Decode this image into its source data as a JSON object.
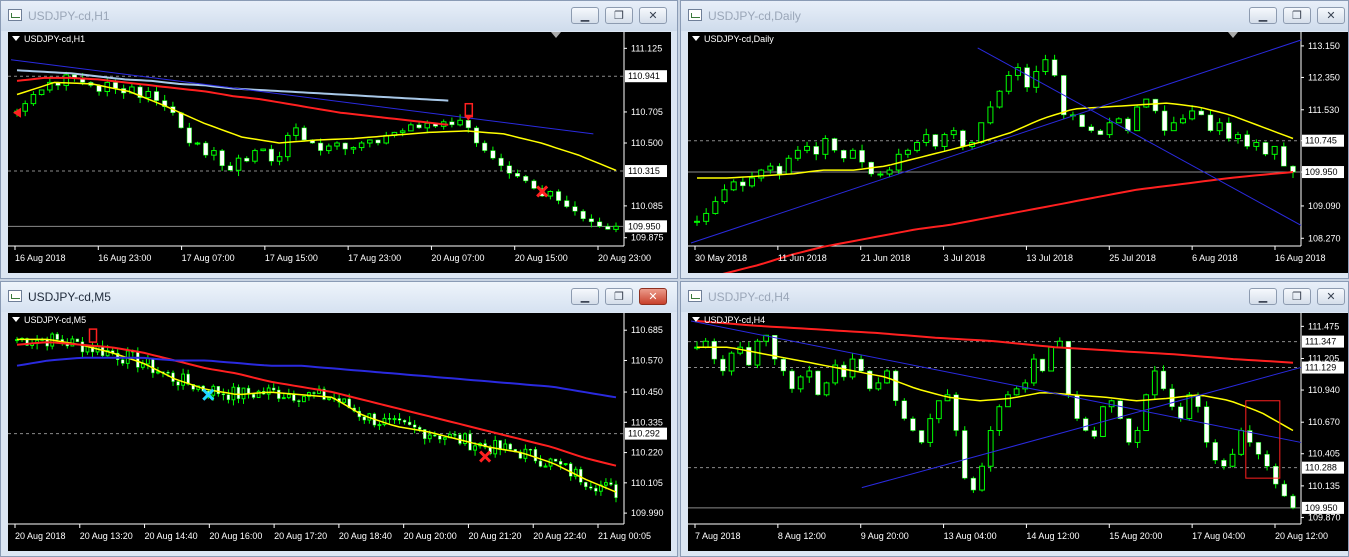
{
  "colors": {
    "up": "#00ff00",
    "ma20": "#ffff00",
    "ma50": "#ff2020",
    "ma100": "#2a2adf",
    "ma_light": "#a8c8e8",
    "axis": "#ffffff",
    "grid": "#8a8a8a"
  },
  "windows": [
    {
      "id": "h1",
      "title": "USDJPY-cd,H1",
      "symbol": "USDJPY-cd,H1",
      "controls": [
        "minimize",
        "restore",
        "close"
      ],
      "chart_data": {
        "type": "candlestick",
        "timeframe": "H1",
        "ylim": [
          109.84,
          111.18
        ],
        "yticks": [
          {
            "v": 111.125,
            "t": "111.125"
          },
          {
            "v": 110.705,
            "t": "110.705"
          },
          {
            "v": 110.5,
            "t": "110.500"
          },
          {
            "v": 110.085,
            "t": "110.085"
          },
          {
            "v": 109.875,
            "t": "109.875"
          }
        ],
        "highlights": [
          {
            "v": 110.941,
            "t": "110.941",
            "dash": true
          },
          {
            "v": 110.315,
            "t": "110.315",
            "dash": true
          },
          {
            "v": 109.95,
            "t": "109.950",
            "dash": false
          }
        ],
        "xlabels": [
          "16 Aug 2018",
          "16 Aug 23:00",
          "17 Aug 07:00",
          "17 Aug 15:00",
          "17 Aug 23:00",
          "20 Aug 07:00",
          "20 Aug 15:00",
          "20 Aug 23:00"
        ],
        "n": 74,
        "closes": [
          110.71,
          110.76,
          110.82,
          110.85,
          110.9,
          110.88,
          110.95,
          110.93,
          110.9,
          110.88,
          110.84,
          110.9,
          110.86,
          110.83,
          110.87,
          110.8,
          110.84,
          110.78,
          110.74,
          110.7,
          110.6,
          110.5,
          110.5,
          110.42,
          110.45,
          110.35,
          110.32,
          110.4,
          110.38,
          110.45,
          110.46,
          110.38,
          110.41,
          110.55,
          110.6,
          110.52,
          110.5,
          110.45,
          110.48,
          110.5,
          110.46,
          110.47,
          110.5,
          110.52,
          110.5,
          110.55,
          110.57,
          110.58,
          110.62,
          110.6,
          110.63,
          110.61,
          110.64,
          110.62,
          110.65,
          110.6,
          110.5,
          110.45,
          110.4,
          110.35,
          110.3,
          110.28,
          110.25,
          110.2,
          110.15,
          110.18,
          110.12,
          110.08,
          110.05,
          110.0,
          109.98,
          109.95,
          109.93,
          109.95
        ],
        "lines": [
          {
            "style": "ma20",
            "from": [
              0,
              110.82
            ],
            "to": [
              73,
              110.32
            ],
            "curve": [
              110.82,
              110.9,
              110.89,
              110.84,
              110.74,
              110.63,
              110.54,
              110.5,
              110.52,
              110.53,
              110.55,
              110.57,
              110.58,
              110.56,
              110.5,
              110.42,
              110.32
            ]
          },
          {
            "style": "ma50",
            "curve": [
              110.91,
              110.93,
              110.93,
              110.92,
              110.9,
              110.88,
              110.86,
              110.84,
              110.81,
              110.79,
              110.76,
              110.73,
              110.7,
              110.68,
              110.66,
              110.64,
              110.62
            ]
          },
          {
            "style": "ma_light",
            "curve": [
              110.98,
              110.97,
              110.96,
              110.94,
              110.92,
              110.91,
              110.89,
              110.88,
              110.86,
              110.85,
              110.84,
              110.83,
              110.82,
              110.81,
              110.8,
              110.79,
              110.78
            ]
          }
        ],
        "trend": [
          [
            0,
            111.05
          ],
          [
            95,
            110.56
          ]
        ],
        "markers": [
          {
            "i": 0,
            "v": 110.7,
            "kind": "red-arrow-left"
          },
          {
            "i": 55,
            "v": 110.7,
            "kind": "red-box-arrow"
          },
          {
            "i": 64,
            "v": 110.18,
            "kind": "red-x"
          }
        ]
      }
    },
    {
      "id": "daily",
      "title": "USDJPY-cd,Daily",
      "symbol": "USDJPY-cd,Daily",
      "controls": [
        "minimize",
        "restore",
        "close"
      ],
      "chart_data": {
        "type": "candlestick",
        "timeframe": "Daily",
        "ylim": [
          108.15,
          113.3
        ],
        "yticks": [
          {
            "v": 113.15,
            "t": "113.150"
          },
          {
            "v": 112.35,
            "t": "112.350"
          },
          {
            "v": 111.53,
            "t": "111.530"
          },
          {
            "v": 110.745,
            "t": "110.745"
          },
          {
            "v": 109.95,
            "t": "109.950"
          },
          {
            "v": 109.09,
            "t": "109.090"
          },
          {
            "v": 108.27,
            "t": "108.270"
          }
        ],
        "highlights": [
          {
            "v": 110.745,
            "t": "110.745",
            "dash": true
          },
          {
            "v": 109.95,
            "t": "109.950",
            "dash": false
          }
        ],
        "xlabels": [
          "30 May 2018",
          "11 Jun 2018",
          "21 Jun 2018",
          "3 Jul 2018",
          "13 Jul 2018",
          "25 Jul 2018",
          "6 Aug 2018",
          "16 Aug 2018"
        ],
        "n": 66,
        "closes": [
          108.7,
          108.9,
          109.2,
          109.5,
          109.7,
          109.6,
          109.8,
          110.0,
          110.1,
          109.9,
          110.3,
          110.5,
          110.6,
          110.4,
          110.8,
          110.5,
          110.3,
          110.5,
          110.2,
          109.9,
          109.9,
          110.0,
          110.4,
          110.5,
          110.7,
          110.9,
          110.6,
          110.9,
          111.0,
          110.6,
          110.7,
          111.2,
          111.6,
          112.0,
          112.4,
          112.6,
          112.1,
          112.5,
          112.8,
          112.4,
          111.4,
          111.4,
          111.1,
          111.0,
          110.9,
          111.2,
          111.3,
          111.0,
          111.6,
          111.8,
          111.5,
          111.0,
          111.2,
          111.3,
          111.5,
          111.4,
          111.0,
          111.2,
          110.8,
          110.9,
          110.6,
          110.7,
          110.4,
          110.6,
          110.1,
          109.95
        ],
        "lines": [
          {
            "style": "ma20",
            "curve": [
              109.8,
              109.8,
              109.85,
              109.9,
              110.0,
              110.0,
              110.1,
              110.3,
              110.5,
              110.7,
              110.95,
              111.3,
              111.55,
              111.6,
              111.65,
              111.7,
              111.6,
              111.4,
              111.1,
              110.8
            ]
          },
          {
            "style": "ma50",
            "curve": [
              107.2,
              107.4,
              107.6,
              107.85,
              108.05,
              108.2,
              108.35,
              108.5,
              108.6,
              108.75,
              108.9,
              109.05,
              109.2,
              109.35,
              109.5,
              109.6,
              109.7,
              109.8,
              109.88,
              109.95
            ]
          }
        ],
        "trend_lines": [
          [
            [
              0,
              108.15
            ],
            [
              66,
              111.05
            ],
            [
              100,
              113.3
            ]
          ],
          [
            [
              47,
              113.1
            ],
            [
              66,
              110.85
            ],
            [
              100,
              108.6
            ]
          ]
        ],
        "markers": []
      }
    },
    {
      "id": "m5",
      "title": "USDJPY-cd,M5",
      "symbol": "USDJPY-cd,M5",
      "controls": [
        "minimize",
        "restore",
        "close"
      ],
      "active": true,
      "chart_data": {
        "type": "candlestick",
        "timeframe": "M5",
        "ylim": [
          109.96,
          110.72
        ],
        "yticks": [
          {
            "v": 110.685,
            "t": "110.685"
          },
          {
            "v": 110.57,
            "t": "110.570"
          },
          {
            "v": 110.45,
            "t": "110.450"
          },
          {
            "v": 110.335,
            "t": "110.335"
          },
          {
            "v": 110.22,
            "t": "110.220"
          },
          {
            "v": 110.105,
            "t": "110.105"
          },
          {
            "v": 109.99,
            "t": "109.990"
          }
        ],
        "highlights": [
          {
            "v": 110.292,
            "t": "110.292",
            "dash": true
          }
        ],
        "xlabels": [
          "20 Aug 2018",
          "20 Aug 13:20",
          "20 Aug 14:40",
          "20 Aug 16:00",
          "20 Aug 17:20",
          "20 Aug 18:40",
          "20 Aug 20:00",
          "20 Aug 21:20",
          "20 Aug 22:40",
          "21 Aug 00:05"
        ],
        "n": 120,
        "lines": [
          {
            "style": "ma20",
            "curve": [
              110.65,
              110.65,
              110.63,
              110.6,
              110.56,
              110.5,
              110.46,
              110.44,
              110.45,
              110.44,
              110.43,
              110.36,
              110.32,
              110.3,
              110.27,
              110.24,
              110.22,
              110.18,
              110.12,
              110.07
            ]
          },
          {
            "style": "ma50",
            "curve": [
              110.63,
              110.64,
              110.63,
              110.62,
              110.6,
              110.57,
              110.54,
              110.52,
              110.49,
              110.47,
              110.45,
              110.42,
              110.39,
              110.36,
              110.33,
              110.3,
              110.27,
              110.24,
              110.2,
              110.17
            ]
          },
          {
            "style": "ma100",
            "curve": [
              110.55,
              110.57,
              110.58,
              110.58,
              110.58,
              110.57,
              110.57,
              110.56,
              110.55,
              110.55,
              110.54,
              110.53,
              110.52,
              110.51,
              110.5,
              110.49,
              110.48,
              110.47,
              110.45,
              110.43
            ]
          }
        ],
        "markers": [
          {
            "i": 15,
            "v": 110.655,
            "kind": "red-box"
          },
          {
            "i": 38,
            "v": 110.44,
            "kind": "cyan-x"
          },
          {
            "i": 93,
            "v": 110.205,
            "kind": "red-x"
          }
        ]
      }
    },
    {
      "id": "h4",
      "title": "USDJPY-cd,H4",
      "symbol": "USDJPY-cd,H4",
      "controls": [
        "minimize",
        "restore",
        "close"
      ],
      "chart_data": {
        "type": "candlestick",
        "timeframe": "H4",
        "ylim": [
          109.84,
          111.52
        ],
        "yticks": [
          {
            "v": 111.475,
            "t": "111.475"
          },
          {
            "v": 111.205,
            "t": "111.205"
          },
          {
            "v": 110.94,
            "t": "110.940"
          },
          {
            "v": 110.67,
            "t": "110.670"
          },
          {
            "v": 110.405,
            "t": "110.405"
          },
          {
            "v": 110.135,
            "t": "110.135"
          },
          {
            "v": 109.87,
            "t": "109.870"
          }
        ],
        "highlights": [
          {
            "v": 111.347,
            "t": "111.347",
            "dash": true
          },
          {
            "v": 111.129,
            "t": "111.129",
            "dash": true
          },
          {
            "v": 110.288,
            "t": "110.288",
            "dash": true
          },
          {
            "v": 109.95,
            "t": "109.950",
            "dash": false
          }
        ],
        "xlabels": [
          "7 Aug 2018",
          "8 Aug 12:00",
          "9 Aug 20:00",
          "13 Aug 04:00",
          "14 Aug 12:00",
          "15 Aug 20:00",
          "17 Aug 04:00",
          "20 Aug 12:00"
        ],
        "n": 70,
        "closes": [
          111.3,
          111.35,
          111.2,
          111.1,
          111.25,
          111.3,
          111.15,
          111.35,
          111.4,
          111.2,
          111.1,
          110.95,
          111.05,
          111.1,
          110.9,
          111.0,
          111.15,
          111.05,
          111.2,
          111.1,
          110.95,
          111.0,
          111.1,
          110.85,
          110.7,
          110.6,
          110.5,
          110.7,
          110.85,
          110.9,
          110.6,
          110.2,
          110.1,
          110.3,
          110.6,
          110.8,
          110.9,
          110.95,
          111.0,
          111.2,
          111.1,
          111.3,
          111.35,
          110.9,
          110.7,
          110.6,
          110.55,
          110.8,
          110.85,
          110.7,
          110.5,
          110.6,
          110.9,
          111.1,
          110.95,
          110.8,
          110.7,
          110.9,
          110.8,
          110.5,
          110.35,
          110.3,
          110.4,
          110.6,
          110.5,
          110.4,
          110.3,
          110.15,
          110.05,
          109.95
        ],
        "lines": [
          {
            "style": "ma20",
            "curve": [
              111.3,
              111.3,
              111.25,
              111.2,
              111.15,
              111.1,
              111.05,
              110.95,
              110.88,
              110.85,
              110.87,
              110.92,
              110.9,
              110.88,
              110.85,
              110.87,
              110.9,
              110.85,
              110.75,
              110.6
            ]
          },
          {
            "style": "ma50",
            "curve": [
              111.52,
              111.48,
              111.45,
              111.42,
              111.38,
              111.35,
              111.3,
              111.27,
              111.24,
              111.2,
              111.17
            ]
          }
        ],
        "trend_lines": [
          [
            [
              0,
              111.52
            ],
            [
              100,
              110.5
            ]
          ],
          [
            [
              28,
              110.12
            ],
            [
              100,
              111.13
            ]
          ]
        ],
        "markers": [
          {
            "i": 64,
            "v": 110.5,
            "kind": "red-rect"
          }
        ]
      }
    }
  ]
}
